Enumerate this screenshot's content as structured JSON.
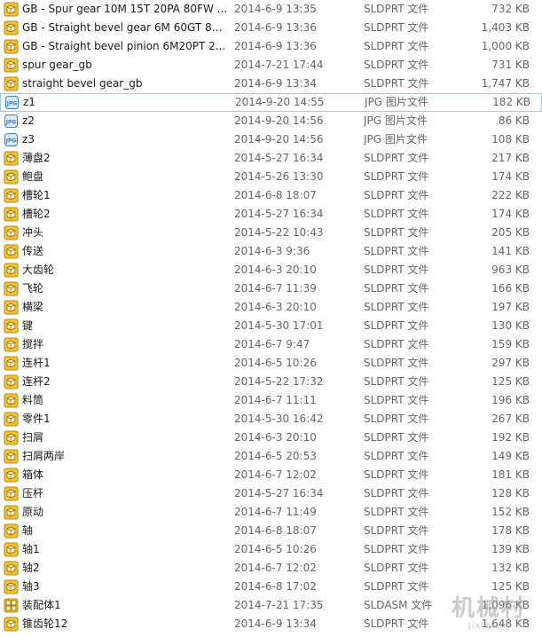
{
  "files": [
    {
      "name": "GB - Spur gear 10M 15T 20PA 80FW ...",
      "date": "2014-6-9 13:35",
      "type": "SLDPRT 文件",
      "size": "732 KB",
      "icon": "sldprt-icon"
    },
    {
      "name": "GB - Straight bevel gear 6M 60GT 80...",
      "date": "2014-6-9 13:36",
      "type": "SLDPRT 文件",
      "size": "1,403 KB",
      "icon": "sldprt-icon"
    },
    {
      "name": "GB - Straight bevel pinion 6M20PT 2...",
      "date": "2014-6-9 13:36",
      "type": "SLDPRT 文件",
      "size": "1,000 KB",
      "icon": "sldprt-icon"
    },
    {
      "name": "spur gear_gb",
      "date": "2014-7-21 17:44",
      "type": "SLDPRT 文件",
      "size": "731 KB",
      "icon": "sldprt-icon"
    },
    {
      "name": "straight bevel gear_gb",
      "date": "2014-6-9 13:34",
      "type": "SLDPRT 文件",
      "size": "1,747 KB",
      "icon": "sldprt-icon"
    },
    {
      "name": "z1",
      "date": "2014-9-20 14:55",
      "type": "JPG 图片文件",
      "size": "182 KB",
      "icon": "jpg-icon",
      "selected": true
    },
    {
      "name": "z2",
      "date": "2014-9-20 14:56",
      "type": "JPG 图片文件",
      "size": "86 KB",
      "icon": "jpg-icon"
    },
    {
      "name": "z3",
      "date": "2014-9-20 14:56",
      "type": "JPG 图片文件",
      "size": "108 KB",
      "icon": "jpg-icon"
    },
    {
      "name": "薄盘2",
      "date": "2014-5-27 16:34",
      "type": "SLDPRT 文件",
      "size": "217 KB",
      "icon": "sldprt-icon"
    },
    {
      "name": "鲍盘",
      "date": "2014-5-26 13:30",
      "type": "SLDPRT 文件",
      "size": "174 KB",
      "icon": "sldprt-icon"
    },
    {
      "name": "槽轮1",
      "date": "2014-6-8 18:07",
      "type": "SLDPRT 文件",
      "size": "222 KB",
      "icon": "sldprt-icon"
    },
    {
      "name": "槽轮2",
      "date": "2014-5-27 16:34",
      "type": "SLDPRT 文件",
      "size": "174 KB",
      "icon": "sldprt-icon"
    },
    {
      "name": "冲头",
      "date": "2014-5-22 10:43",
      "type": "SLDPRT 文件",
      "size": "205 KB",
      "icon": "sldprt-icon"
    },
    {
      "name": "传送",
      "date": "2014-6-3 9:36",
      "type": "SLDPRT 文件",
      "size": "141 KB",
      "icon": "sldprt-icon"
    },
    {
      "name": "大齿轮",
      "date": "2014-6-3 20:10",
      "type": "SLDPRT 文件",
      "size": "963 KB",
      "icon": "sldprt-icon"
    },
    {
      "name": "飞轮",
      "date": "2014-6-7 11:39",
      "type": "SLDPRT 文件",
      "size": "166 KB",
      "icon": "sldprt-icon"
    },
    {
      "name": "横梁",
      "date": "2014-6-3 20:10",
      "type": "SLDPRT 文件",
      "size": "197 KB",
      "icon": "sldprt-icon"
    },
    {
      "name": "键",
      "date": "2014-5-30 17:01",
      "type": "SLDPRT 文件",
      "size": "130 KB",
      "icon": "sldprt-icon"
    },
    {
      "name": "搅拌",
      "date": "2014-6-7 9:47",
      "type": "SLDPRT 文件",
      "size": "159 KB",
      "icon": "sldprt-icon"
    },
    {
      "name": "连杆1",
      "date": "2014-6-5 10:26",
      "type": "SLDPRT 文件",
      "size": "297 KB",
      "icon": "sldprt-icon"
    },
    {
      "name": "连杆2",
      "date": "2014-5-22 17:32",
      "type": "SLDPRT 文件",
      "size": "125 KB",
      "icon": "sldprt-icon"
    },
    {
      "name": "料筒",
      "date": "2014-6-7 11:11",
      "type": "SLDPRT 文件",
      "size": "196 KB",
      "icon": "sldprt-icon"
    },
    {
      "name": "零件1",
      "date": "2014-5-30 16:42",
      "type": "SLDPRT 文件",
      "size": "267 KB",
      "icon": "sldprt-icon"
    },
    {
      "name": "扫屑",
      "date": "2014-6-3 20:10",
      "type": "SLDPRT 文件",
      "size": "192 KB",
      "icon": "sldprt-icon"
    },
    {
      "name": "扫屑两岸",
      "date": "2014-6-5 20:53",
      "type": "SLDPRT 文件",
      "size": "149 KB",
      "icon": "sldprt-icon"
    },
    {
      "name": "箱体",
      "date": "2014-6-7 12:02",
      "type": "SLDPRT 文件",
      "size": "181 KB",
      "icon": "sldprt-icon"
    },
    {
      "name": "压杆",
      "date": "2014-5-27 16:34",
      "type": "SLDPRT 文件",
      "size": "128 KB",
      "icon": "sldprt-icon"
    },
    {
      "name": "原动",
      "date": "2014-6-7 11:49",
      "type": "SLDPRT 文件",
      "size": "152 KB",
      "icon": "sldprt-icon"
    },
    {
      "name": "轴",
      "date": "2014-6-8 18:07",
      "type": "SLDPRT 文件",
      "size": "178 KB",
      "icon": "sldprt-icon"
    },
    {
      "name": "轴1",
      "date": "2014-6-5 10:26",
      "type": "SLDPRT 文件",
      "size": "139 KB",
      "icon": "sldprt-icon"
    },
    {
      "name": "轴2",
      "date": "2014-6-7 12:02",
      "type": "SLDPRT 文件",
      "size": "132 KB",
      "icon": "sldprt-icon"
    },
    {
      "name": "轴3",
      "date": "2014-6-8 17:02",
      "type": "SLDPRT 文件",
      "size": "125 KB",
      "icon": "sldprt-icon"
    },
    {
      "name": "装配体1",
      "date": "2014-7-21 17:35",
      "type": "SLDASM 文件",
      "size": "1,096 KB",
      "icon": "sldasm-icon"
    },
    {
      "name": "锥齿轮12",
      "date": "2014-6-9 13:34",
      "type": "SLDPRT 文件",
      "size": "1,648 KB",
      "icon": "sldprt-icon"
    }
  ],
  "watermark": {
    "cn": "机械村",
    "en": "Jixiecun"
  },
  "colors": {
    "selection_border": "#99c9f2",
    "sldprt_icon": "#e8b21a",
    "jpg_icon": "#3d7fc1"
  }
}
